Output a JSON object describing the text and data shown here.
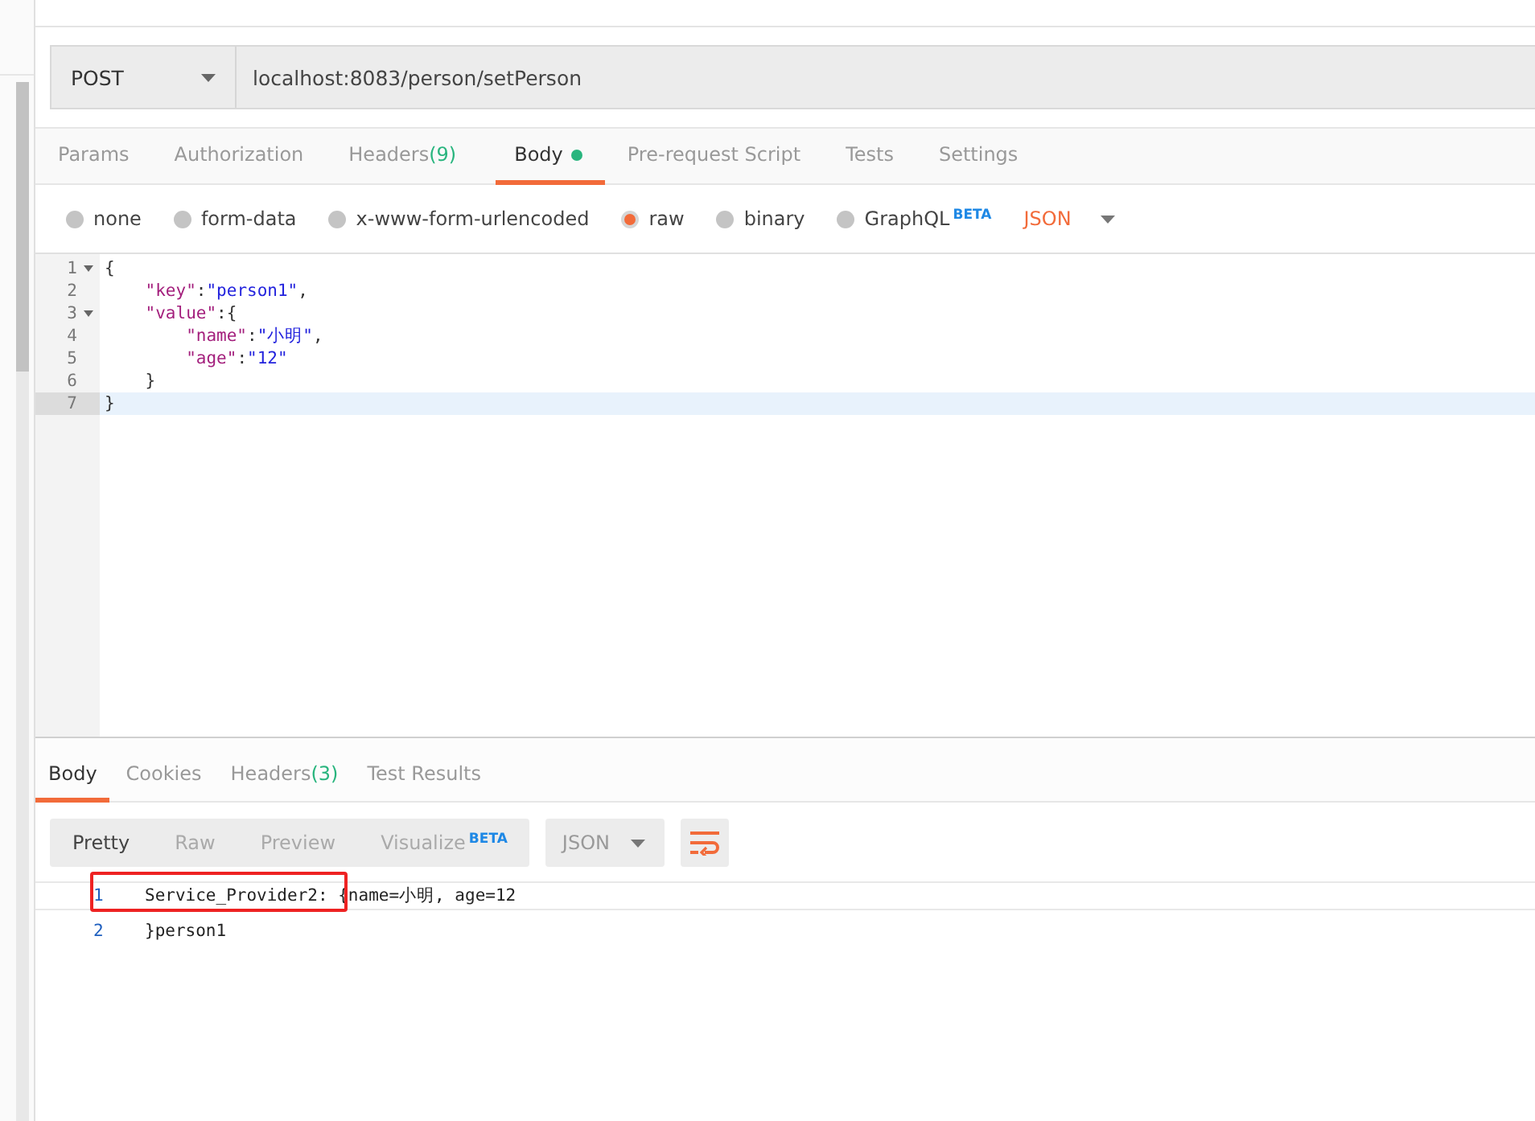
{
  "request": {
    "method": "POST",
    "url": "localhost:8083/person/setPerson"
  },
  "tabs": [
    {
      "label": "Params",
      "selected": false
    },
    {
      "label": "Authorization",
      "selected": false
    },
    {
      "label": "Headers",
      "count": "(9)",
      "selected": false
    },
    {
      "label": "Body",
      "dot": true,
      "selected": true
    },
    {
      "label": "Pre-request Script",
      "selected": false
    },
    {
      "label": "Tests",
      "selected": false
    },
    {
      "label": "Settings",
      "selected": false
    }
  ],
  "body_types": [
    {
      "label": "none",
      "selected": false
    },
    {
      "label": "form-data",
      "selected": false
    },
    {
      "label": "x-www-form-urlencoded",
      "selected": false
    },
    {
      "label": "raw",
      "selected": true
    },
    {
      "label": "binary",
      "selected": false
    },
    {
      "label": "GraphQL",
      "badge": "BETA",
      "selected": false
    }
  ],
  "format": "JSON",
  "editor": {
    "lines": [
      {
        "number": "1",
        "foldable": true,
        "current": false,
        "tokens": [
          {
            "text": "{",
            "kind": "punct"
          }
        ]
      },
      {
        "number": "2",
        "foldable": false,
        "current": false,
        "tokens": [
          {
            "text": "    \"key\"",
            "kind": "key"
          },
          {
            "text": ":",
            "kind": "punct"
          },
          {
            "text": "\"person1\"",
            "kind": "string"
          },
          {
            "text": ",",
            "kind": "punct"
          }
        ]
      },
      {
        "number": "3",
        "foldable": true,
        "current": false,
        "tokens": [
          {
            "text": "    \"value\"",
            "kind": "key"
          },
          {
            "text": ":{",
            "kind": "punct"
          }
        ]
      },
      {
        "number": "4",
        "foldable": false,
        "current": false,
        "tokens": [
          {
            "text": "        \"name\"",
            "kind": "key"
          },
          {
            "text": ":",
            "kind": "punct"
          },
          {
            "text": "\"小明\"",
            "kind": "string"
          },
          {
            "text": ",",
            "kind": "punct"
          }
        ]
      },
      {
        "number": "5",
        "foldable": false,
        "current": false,
        "tokens": [
          {
            "text": "        \"age\"",
            "kind": "key"
          },
          {
            "text": ":",
            "kind": "punct"
          },
          {
            "text": "\"12\"",
            "kind": "string"
          }
        ]
      },
      {
        "number": "6",
        "foldable": false,
        "current": false,
        "tokens": [
          {
            "text": "    }",
            "kind": "punct"
          }
        ]
      },
      {
        "number": "7",
        "foldable": false,
        "current": true,
        "tokens": [
          {
            "text": "}",
            "kind": "punct"
          }
        ]
      }
    ]
  },
  "response_tabs": [
    {
      "label": "Body",
      "selected": true
    },
    {
      "label": "Cookies",
      "selected": false
    },
    {
      "label": "Headers",
      "count": "(3)",
      "selected": false
    },
    {
      "label": "Test Results",
      "selected": false
    }
  ],
  "view_modes": [
    {
      "label": "Pretty",
      "selected": true
    },
    {
      "label": "Raw",
      "selected": false
    },
    {
      "label": "Preview",
      "selected": false
    },
    {
      "label": "Visualize",
      "badge": "BETA",
      "selected": false
    }
  ],
  "response_format": "JSON",
  "response": {
    "lines": [
      {
        "number": "1",
        "current": true,
        "text": "Service_Provider2: {name=小明, age=12"
      },
      {
        "number": "2",
        "current": false,
        "text": "}person1"
      }
    ]
  }
}
